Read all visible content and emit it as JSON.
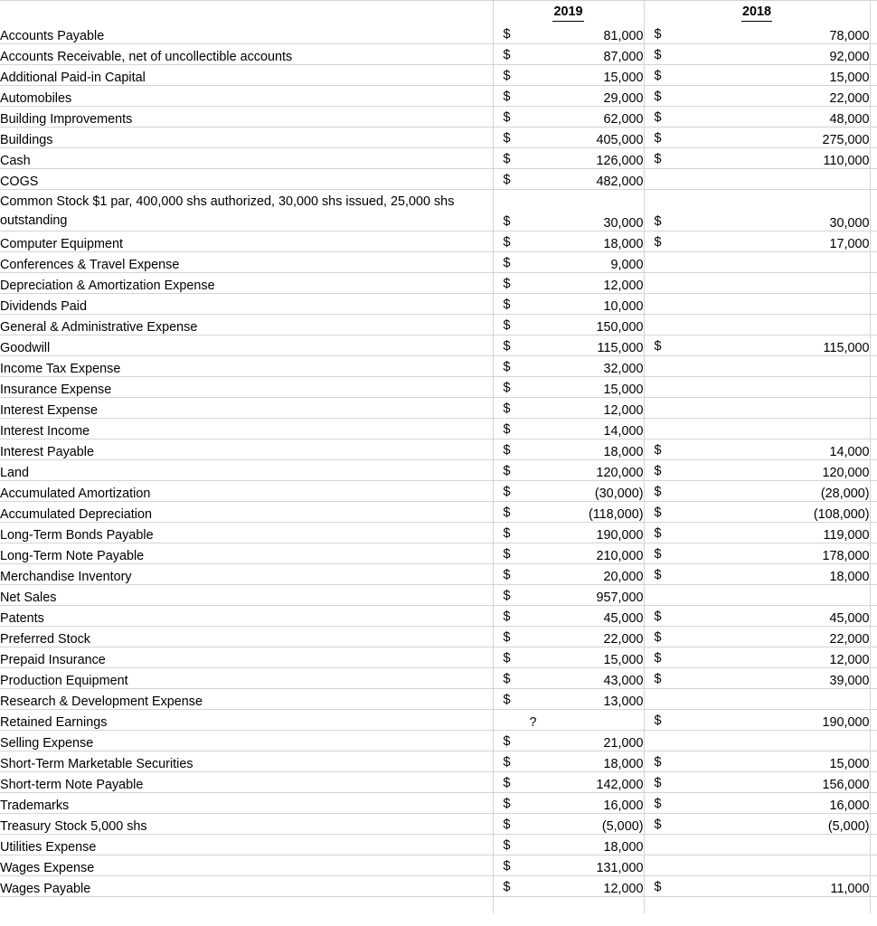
{
  "sheet": {
    "type": "spreadsheet-trial-balance",
    "columns": {
      "label_header": "",
      "year_current": "2019",
      "year_prior": "2018"
    },
    "currency_symbol": "$",
    "unknown_marker": "?",
    "rows": [
      {
        "label": "Accounts Payable",
        "y2019": "81,000",
        "y2018": "78,000"
      },
      {
        "label": "Accounts Receivable, net of uncollectible accounts",
        "y2019": "87,000",
        "y2018": "92,000"
      },
      {
        "label": "Additional Paid-in Capital",
        "y2019": "15,000",
        "y2018": "15,000"
      },
      {
        "label": "Automobiles",
        "y2019": "29,000",
        "y2018": "22,000"
      },
      {
        "label": "Building Improvements",
        "y2019": "62,000",
        "y2018": "48,000"
      },
      {
        "label": "Buildings",
        "y2019": "405,000",
        "y2018": "275,000"
      },
      {
        "label": "Cash",
        "y2019": "126,000",
        "y2018": "110,000"
      },
      {
        "label": "COGS",
        "y2019": "482,000",
        "y2018": ""
      },
      {
        "label": "Common Stock $1 par, 400,000 shs authorized, 30,000 shs issued, 25,000 shs outstanding",
        "y2019": "30,000",
        "y2018": "30,000",
        "two_line": true
      },
      {
        "label": "Computer Equipment",
        "y2019": "18,000",
        "y2018": "17,000"
      },
      {
        "label": "Conferences & Travel Expense",
        "y2019": "9,000",
        "y2018": ""
      },
      {
        "label": "Depreciation & Amortization Expense",
        "y2019": "12,000",
        "y2018": ""
      },
      {
        "label": "Dividends Paid",
        "y2019": "10,000",
        "y2018": ""
      },
      {
        "label": "General & Administrative Expense",
        "y2019": "150,000",
        "y2018": ""
      },
      {
        "label": "Goodwill",
        "y2019": "115,000",
        "y2018": "115,000"
      },
      {
        "label": "Income Tax Expense",
        "y2019": "32,000",
        "y2018": ""
      },
      {
        "label": "Insurance Expense",
        "y2019": "15,000",
        "y2018": ""
      },
      {
        "label": "Interest Expense",
        "y2019": "12,000",
        "y2018": ""
      },
      {
        "label": "Interest Income",
        "y2019": "14,000",
        "y2018": ""
      },
      {
        "label": "Interest Payable",
        "y2019": "18,000",
        "y2018": "14,000"
      },
      {
        "label": "Land",
        "y2019": "120,000",
        "y2018": "120,000"
      },
      {
        "label": "Accumulated Amortization",
        "y2019": "(30,000)",
        "y2018": "(28,000)"
      },
      {
        "label": "Accumulated Depreciation",
        "y2019": "(118,000)",
        "y2018": "(108,000)"
      },
      {
        "label": "Long-Term Bonds Payable",
        "y2019": "190,000",
        "y2018": "119,000"
      },
      {
        "label": "Long-Term Note Payable",
        "y2019": "210,000",
        "y2018": "178,000"
      },
      {
        "label": "Merchandise Inventory",
        "y2019": "20,000",
        "y2018": "18,000"
      },
      {
        "label": "Net Sales",
        "y2019": "957,000",
        "y2018": ""
      },
      {
        "label": "Patents",
        "y2019": "45,000",
        "y2018": "45,000"
      },
      {
        "label": "Preferred Stock",
        "y2019": "22,000",
        "y2018": "22,000"
      },
      {
        "label": "Prepaid Insurance",
        "y2019": "15,000",
        "y2018": "12,000"
      },
      {
        "label": "Production Equipment",
        "y2019": "43,000",
        "y2018": "39,000"
      },
      {
        "label": "Research & Development Expense",
        "y2019": "13,000",
        "y2018": ""
      },
      {
        "label": "Retained Earnings",
        "y2019": "?",
        "y2018": "190,000",
        "y2019_unknown": true
      },
      {
        "label": "Selling Expense",
        "y2019": "21,000",
        "y2018": ""
      },
      {
        "label": "Short-Term Marketable Securities",
        "y2019": "18,000",
        "y2018": "15,000"
      },
      {
        "label": "Short-term Note Payable",
        "y2019": "142,000",
        "y2018": "156,000"
      },
      {
        "label": "Trademarks",
        "y2019": "16,000",
        "y2018": "16,000"
      },
      {
        "label": "Treasury Stock 5,000 shs",
        "y2019": "(5,000)",
        "y2018": "(5,000)"
      },
      {
        "label": "Utilities Expense",
        "y2019": "18,000",
        "y2018": ""
      },
      {
        "label": "Wages Expense",
        "y2019": "131,000",
        "y2018": ""
      },
      {
        "label": "Wages Payable",
        "y2019": "12,000",
        "y2018": "11,000"
      }
    ]
  }
}
